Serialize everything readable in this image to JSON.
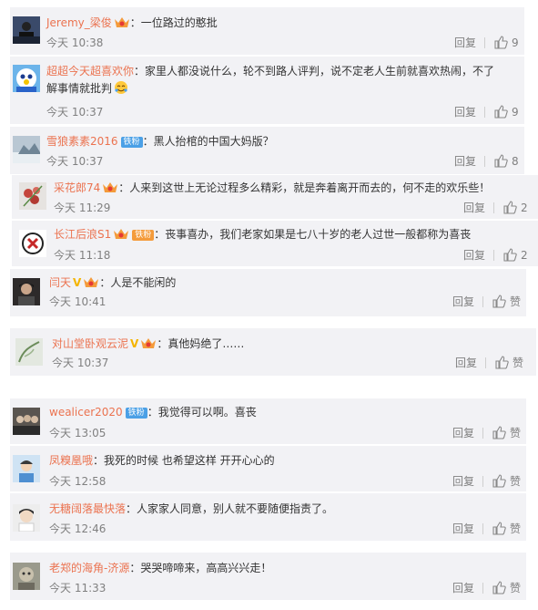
{
  "reply_label": "回复",
  "like_zero_label": "赞",
  "colon": "：",
  "comments": [
    {
      "user": "Jeremy_梁俊",
      "crown": true,
      "text": "一位路过的憨批",
      "time": "今天 10:38",
      "likes": "9"
    },
    {
      "user": "超超今天超喜欢你",
      "crown": true,
      "text": "家里人都没说什么，轮不到路人评判，说不定老人生前就喜欢热闹，不了",
      "text2": "解事情就批判",
      "time": "今天 10:37",
      "likes": "9"
    },
    {
      "user": "雪狼素素2016",
      "badge": "铁粉",
      "text": "黑人抬棺的中国大妈版？",
      "time": "今天 10:37",
      "likes": "8"
    },
    {
      "user": "采花郎74",
      "crown": true,
      "text": "人来到这世上无论过程多么精彩，就是奔着离开而去的，何不走的欢乐些！",
      "time": "今天 11:29",
      "likes": "2"
    },
    {
      "user": "长江后浪S1",
      "crown": true,
      "badge": "铁粉",
      "text": "丧事喜办，我们老家如果是七八十岁的老人过世一般都称为喜丧",
      "time": "今天 11:18",
      "likes": "2"
    },
    {
      "user": "闫天",
      "verified": "V",
      "crown": true,
      "text": "人是不能闲的",
      "time": "今天 10:41",
      "likes": "赞"
    },
    {
      "user": "对山堂卧观云泥",
      "verified": "V",
      "crown": true,
      "text": "真他妈绝了……",
      "time": "今天 10:37",
      "likes": "赞"
    },
    {
      "user": "wealicer2020",
      "badge": "铁粉",
      "text": "我觉得可以啊。喜丧",
      "time": "今天 13:05",
      "likes": "赞"
    },
    {
      "user": "凤糗凰哦",
      "text": "我死的时候 也希望这样  开开心心的",
      "time": "今天 12:58",
      "likes": "赞"
    },
    {
      "user": "无糖阔落最快落",
      "text": "人家家人同意，别人就不要随便指责了。",
      "time": "今天 12:46",
      "likes": "赞"
    },
    {
      "user": "老郑的海角-济源",
      "text": "哭哭啼啼来，高高兴兴走！",
      "time": "今天 11:33",
      "likes": "赞"
    }
  ],
  "colors": {
    "username": "#eb7350",
    "card_bg": "#f2f2f5",
    "meta": "#808080",
    "fan_badge": "#4ba0e6",
    "verified": "#f4b400"
  }
}
